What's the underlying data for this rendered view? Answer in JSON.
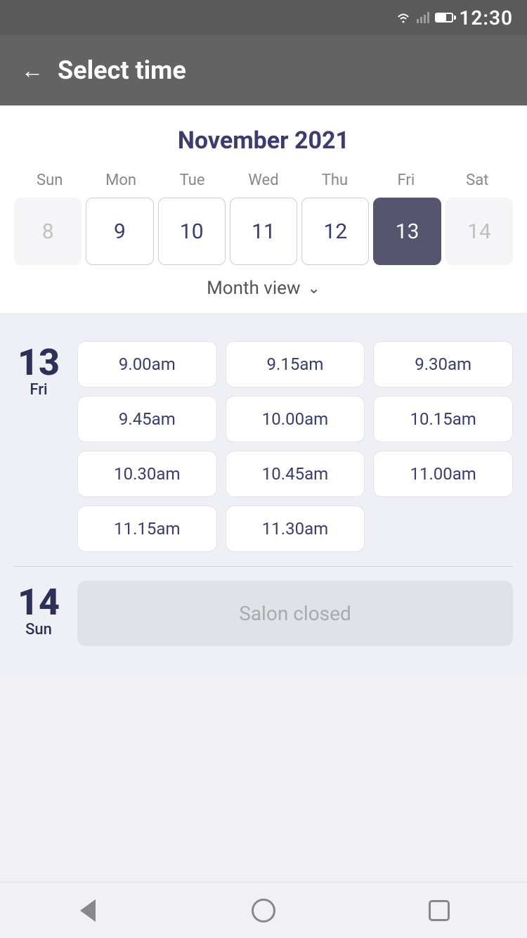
{
  "statusBar": {
    "time": "12:30"
  },
  "header": {
    "backLabel": "←",
    "title": "Select time"
  },
  "calendar": {
    "monthTitle": "November 2021",
    "dayHeaders": [
      "Sun",
      "Mon",
      "Tue",
      "Wed",
      "Thu",
      "Fri",
      "Sat"
    ],
    "weekDays": [
      {
        "date": "8",
        "state": "inactive"
      },
      {
        "date": "9",
        "state": "bordered"
      },
      {
        "date": "10",
        "state": "bordered"
      },
      {
        "date": "11",
        "state": "bordered"
      },
      {
        "date": "12",
        "state": "bordered"
      },
      {
        "date": "13",
        "state": "selected"
      },
      {
        "date": "14",
        "state": "inactive"
      }
    ],
    "monthViewLabel": "Month view",
    "chevron": "⌄"
  },
  "timeSections": [
    {
      "dayNumber": "13",
      "dayName": "Fri",
      "slots": [
        "9.00am",
        "9.15am",
        "9.30am",
        "9.45am",
        "10.00am",
        "10.15am",
        "10.30am",
        "10.45am",
        "11.00am",
        "11.15am",
        "11.30am"
      ]
    },
    {
      "dayNumber": "14",
      "dayName": "Sun",
      "closed": true,
      "closedText": "Salon closed"
    }
  ],
  "navBar": {
    "back": "back",
    "home": "home",
    "recents": "recents"
  }
}
